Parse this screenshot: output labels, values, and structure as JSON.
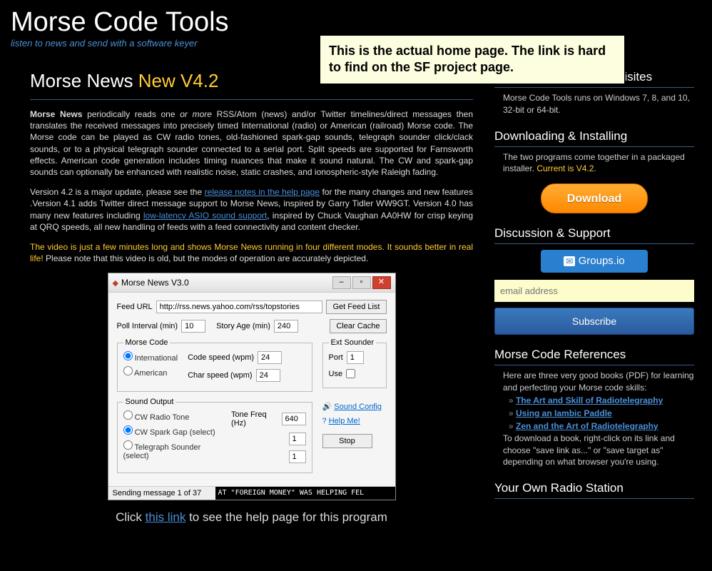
{
  "header": {
    "title": "Morse Code Tools",
    "tagline": "listen to news and send with a software keyer"
  },
  "callout": "This is the actual home page. The link is hard to find on the SF project page.",
  "content": {
    "heading_pre": "Morse News ",
    "heading_ver": "New V4.2",
    "para1_strong": "Morse News",
    "para1_a": " periodically reads one ",
    "para1_i": "or more",
    "para1_b": " RSS/Atom (news) and/or Twitter timelines/direct messages then translates the received messages into precisely timed International (radio) or American (railroad) Morse code. The Morse code can be played as CW radio tones, old-fashioned spark-gap sounds, telegraph sounder click/clack sounds, or to a physical telegraph sounder connected to a serial port. Split speeds are supported for Farnsworth effects. American code generation includes timing nuances that make it sound natural. The CW and spark-gap sounds can optionally be enhanced with realistic noise, static crashes, and ionospheric-style Raleigh fading.",
    "para2_a": "Version 4.2 is a major update, please see the ",
    "para2_link1": "release notes in the help page",
    "para2_b": " for the many changes and new features .Version 4.1 adds Twitter direct message support to Morse News, inspired by Garry Tidler WW9GT. Version 4.0 has many new features including ",
    "para2_link2": "low-latency ASIO sound support",
    "para2_c": ", inspired by Chuck Vaughan AA0HW for crisp keying at QRQ speeds, all new handling of feeds with a feed connectivity and content checker.",
    "video_hl": "The video is just a few minutes long and shows Morse News running in four different modes. It sounds better in real life!",
    "video_rest": " Please note that this video is old, but the modes of operation are accurately depicted.",
    "help_pre": "Click ",
    "help_link": "this link",
    "help_post": " to see the help page for this program"
  },
  "app": {
    "title": "Morse News V3.0",
    "feed_label": "Feed URL",
    "feed_value": "http://rss.news.yahoo.com/rss/topstories",
    "get_feed": "Get Feed List",
    "poll_label": "Poll Interval (min)",
    "poll_val": "10",
    "story_label": "Story Age (min)",
    "story_val": "240",
    "clear": "Clear Cache",
    "morse_legend": "Morse Code",
    "intl": "International",
    "amer": "American",
    "code_speed": "Code speed (wpm)",
    "code_val": "24",
    "char_speed": "Char speed (wpm)",
    "char_val": "24",
    "ext_legend": "Ext Sounder",
    "port": "Port",
    "port_val": "1",
    "use": "Use",
    "sound_legend": "Sound Output",
    "cw_tone": "CW Radio Tone",
    "cw_spark": "CW Spark Gap (select)",
    "tel_sounder": "Telegraph Sounder (select)",
    "tone_freq": "Tone Freq (Hz)",
    "tone_val": "640",
    "one": "1",
    "sound_config": "Sound Config",
    "help_me": "Help Me!",
    "stop": "Stop",
    "status_l": "Sending message 1 of 37",
    "status_r": "AT \"FOREIGN MONEY\" WAS HELPING FEL"
  },
  "sidebar": {
    "os_h": "OS Support & Pre-Requisites",
    "os_p": "Morse Code Tools runs on Windows 7, 8, and 10, 32-bit or 64-bit.",
    "dl_h": "Downloading & Installing",
    "dl_p": "The two programs come together in a packaged installer. ",
    "dl_cur": "Current is V4.2",
    "dl_btn": "Download",
    "disc_h": "Discussion & Support",
    "groups": "Groups.io",
    "email_ph": "email address",
    "subscribe": "Subscribe",
    "ref_h": "Morse Code References",
    "ref_p": "Here are three very good books (PDF) for learning and perfecting your Morse code skills:",
    "ref1": "The Art and Skill of Radiotelegraphy",
    "ref2": "Using an Iambic Paddle",
    "ref3": "Zen and the Art of Radiotelegraphy",
    "ref_p2": "To download a book, right-click on its link and choose \"save link as...\" or \"save target as\" depending on what browser you're using.",
    "radio_h": "Your Own Radio Station"
  }
}
